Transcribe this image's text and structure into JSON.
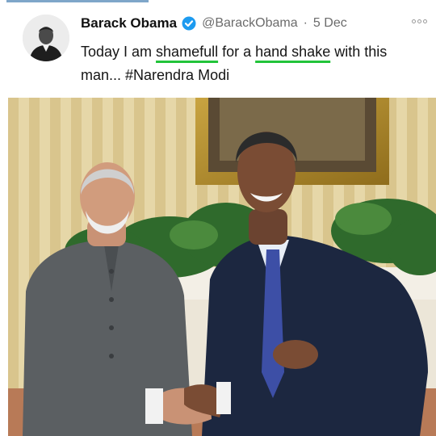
{
  "tweet": {
    "author_name": "Barack Obama",
    "handle": "@BarackObama",
    "separator": "·",
    "date": "5 Dec",
    "text_parts": [
      "Today I am ",
      "shamefull",
      " for a ",
      "hand shake",
      " with this man... #Narendra Modi"
    ]
  },
  "icons": {
    "verified": "verified-badge-icon",
    "more": "more-options-icon",
    "avatar": "profile-avatar"
  },
  "colors": {
    "verified": "#1d9bf0",
    "highlight_underline": "#22c43a",
    "handle_text": "#6b6b6b"
  }
}
